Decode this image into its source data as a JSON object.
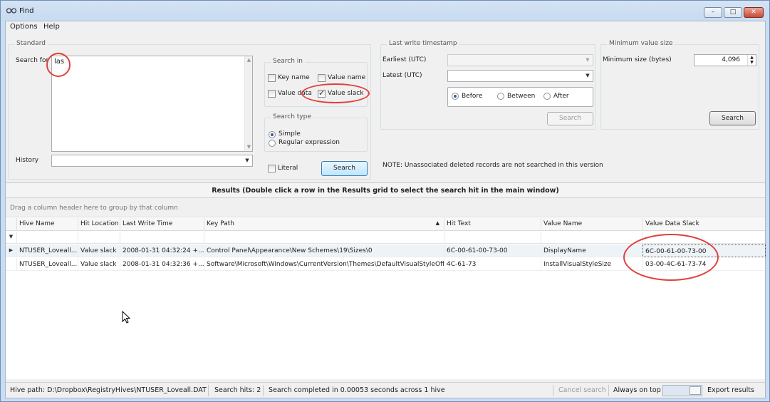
{
  "window": {
    "title": "Find",
    "controls": [
      "–",
      "□",
      "✕"
    ]
  },
  "menu": [
    "Options",
    "Help"
  ],
  "standard": {
    "group_label": "Standard",
    "search_for_label": "Search for",
    "search_for_value": "las",
    "history_label": "History",
    "history_value": "",
    "search_in": {
      "label": "Search in",
      "key_name": {
        "label": "Key name",
        "checked": false
      },
      "value_name": {
        "label": "Value name",
        "checked": false
      },
      "value_data": {
        "label": "Value data",
        "checked": false
      },
      "value_slack": {
        "label": "Value slack",
        "checked": true
      }
    },
    "search_type": {
      "label": "Search type",
      "simple": "Simple",
      "regex": "Regular expression",
      "selected": "simple"
    },
    "literal": {
      "label": "Literal",
      "checked": false
    },
    "search_button": "Search"
  },
  "timestamp": {
    "group_label": "Last write timestamp",
    "earliest_label": "Earliest (UTC)",
    "latest_label": "Latest (UTC)",
    "earliest_value": "",
    "latest_value": "",
    "before": "Before",
    "between": "Between",
    "after": "After",
    "selected": "before",
    "search_button": "Search",
    "note": "NOTE: Unassociated deleted records are not searched in this version"
  },
  "min_value": {
    "group_label": "Minimum value size",
    "label": "Minimum size (bytes)",
    "value": "4,096",
    "search_button": "Search"
  },
  "results": {
    "title": "Results (Double click a row in the Results grid to select the search hit in the main window)",
    "group_hint": "Drag a column header here to group by that column",
    "columns": [
      "Hive Name",
      "Hit Location",
      "Last Write Time",
      "Key Path",
      "Hit Text",
      "Value Name",
      "Value Data Slack"
    ],
    "rows": [
      {
        "hive": "NTUSER_Loveall...",
        "location": "Value slack",
        "time": "2008-01-31 04:32:24 +...",
        "key_path": "Control Panel\\Appearance\\New Schemes\\19\\Sizes\\0",
        "hit_text": "6C-00-61-00-73-00",
        "value_name": "DisplayName",
        "slack": "6C-00-61-00-73-00"
      },
      {
        "hive": "NTUSER_Loveall...",
        "location": "Value slack",
        "time": "2008-01-31 04:32:36 +...",
        "key_path": "Software\\Microsoft\\Windows\\CurrentVersion\\Themes\\DefaultVisualStyleOff",
        "hit_text": "4C-61-73",
        "value_name": "InstallVisualStyleSize",
        "slack": "03-00-4C-61-73-74"
      }
    ]
  },
  "status": {
    "hive_path": "Hive path: D:\\Dropbox\\RegistryHives\\NTUSER_Loveall.DAT",
    "hits": "Search hits: 2",
    "completed": "Search completed in 0.00053 seconds across 1 hive",
    "cancel": "Cancel search",
    "always_on_top": "Always on top",
    "export": "Export results"
  },
  "colors": {
    "annotation": "#e0403c",
    "accent": "#3c7fb1"
  }
}
